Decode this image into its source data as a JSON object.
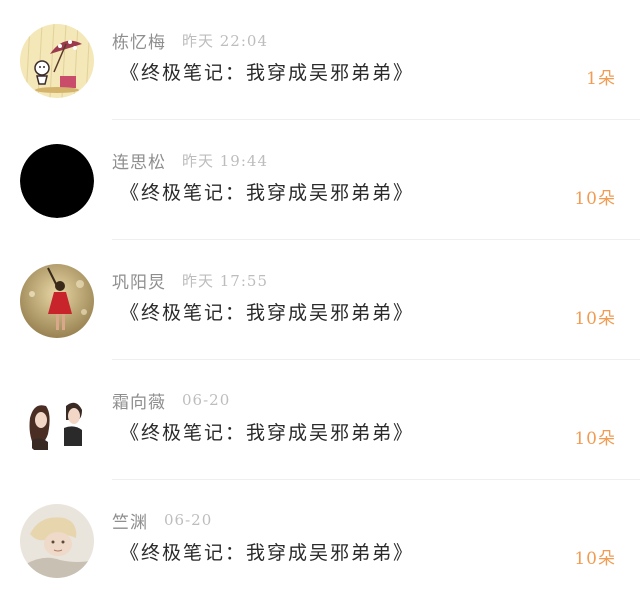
{
  "gifts": [
    {
      "name": "栋忆梅",
      "time": "昨天 22:04",
      "gift": "《终极笔记：我穿成吴邪弟弟》",
      "count": "1朵",
      "avatar_icon": "girl-umbrella-cartoon-avatar-icon"
    },
    {
      "name": "连思松",
      "time": "昨天 19:44",
      "gift": "《终极笔记：我穿成吴邪弟弟》",
      "count": "10朵",
      "avatar_icon": "black-circle-avatar-icon"
    },
    {
      "name": "巩阳炅",
      "time": "昨天 17:55",
      "gift": "《终极笔记：我穿成吴邪弟弟》",
      "count": "10朵",
      "avatar_icon": "red-dress-girl-avatar-icon"
    },
    {
      "name": "霜向薇",
      "time": "06-20",
      "gift": "《终极笔记：我穿成吴邪弟弟》",
      "count": "10朵",
      "avatar_icon": "couple-illustration-avatar-icon"
    },
    {
      "name": "竺渊",
      "time": "06-20",
      "gift": "《终极笔记：我穿成吴邪弟弟》",
      "count": "10朵",
      "avatar_icon": "blond-person-photo-avatar-icon"
    }
  ],
  "colors": {
    "name": "#8e8e8e",
    "time": "#bdbdbd",
    "gift": "#2b2b2b",
    "count": "#f19c52",
    "divider": "#efefef"
  }
}
